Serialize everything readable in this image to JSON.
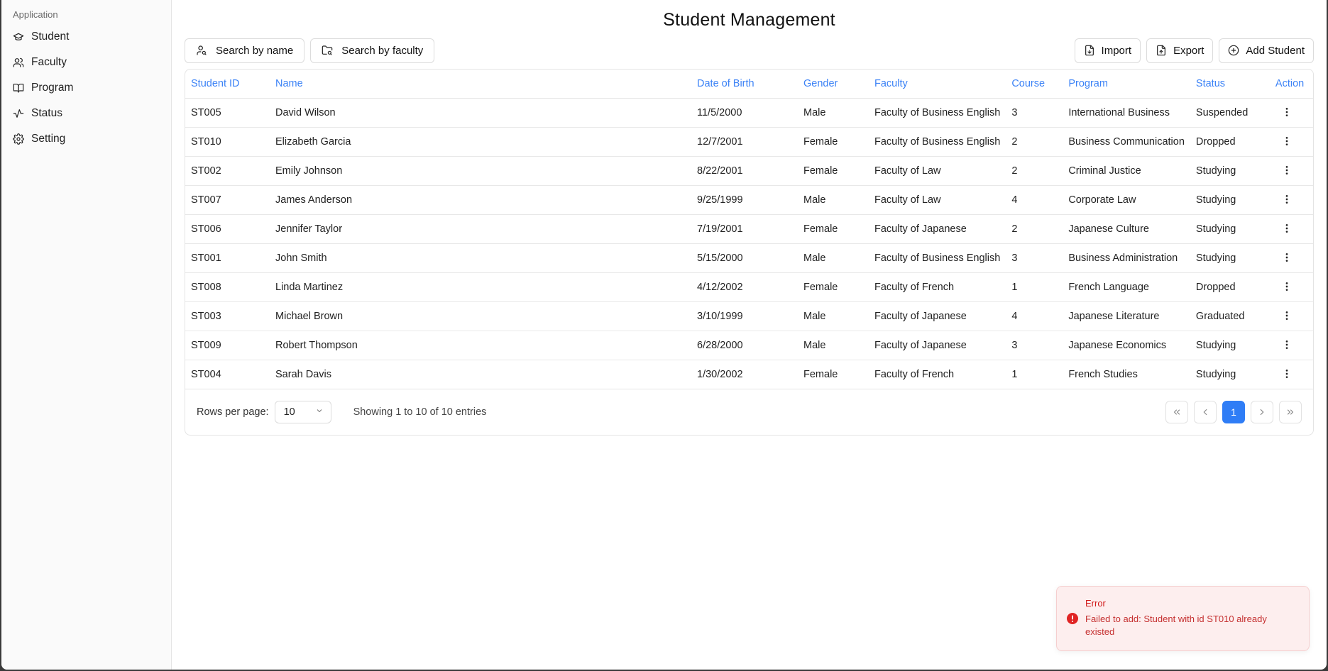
{
  "sidebar": {
    "group_label": "Application",
    "items": [
      {
        "label": "Student",
        "icon": "graduation-cap-icon"
      },
      {
        "label": "Faculty",
        "icon": "users-icon"
      },
      {
        "label": "Program",
        "icon": "book-open-icon"
      },
      {
        "label": "Status",
        "icon": "activity-icon"
      },
      {
        "label": "Setting",
        "icon": "gear-icon"
      }
    ]
  },
  "header": {
    "title": "Student Management"
  },
  "toolbar": {
    "search_name_label": "Search by name",
    "search_faculty_label": "Search by faculty",
    "import_label": "Import",
    "export_label": "Export",
    "add_label": "Add Student"
  },
  "table": {
    "columns": [
      "Student ID",
      "Name",
      "Date of Birth",
      "Gender",
      "Faculty",
      "Course",
      "Program",
      "Status",
      "Action"
    ],
    "rows": [
      [
        "ST005",
        "David Wilson",
        "11/5/2000",
        "Male",
        "Faculty of Business English",
        "3",
        "International Business",
        "Suspended"
      ],
      [
        "ST010",
        "Elizabeth Garcia",
        "12/7/2001",
        "Female",
        "Faculty of Business English",
        "2",
        "Business Communication",
        "Dropped"
      ],
      [
        "ST002",
        "Emily Johnson",
        "8/22/2001",
        "Female",
        "Faculty of Law",
        "2",
        "Criminal Justice",
        "Studying"
      ],
      [
        "ST007",
        "James Anderson",
        "9/25/1999",
        "Male",
        "Faculty of Law",
        "4",
        "Corporate Law",
        "Studying"
      ],
      [
        "ST006",
        "Jennifer Taylor",
        "7/19/2001",
        "Female",
        "Faculty of Japanese",
        "2",
        "Japanese Culture",
        "Studying"
      ],
      [
        "ST001",
        "John Smith",
        "5/15/2000",
        "Male",
        "Faculty of Business English",
        "3",
        "Business Administration",
        "Studying"
      ],
      [
        "ST008",
        "Linda Martinez",
        "4/12/2002",
        "Female",
        "Faculty of French",
        "1",
        "French Language",
        "Dropped"
      ],
      [
        "ST003",
        "Michael Brown",
        "3/10/1999",
        "Male",
        "Faculty of Japanese",
        "4",
        "Japanese Literature",
        "Graduated"
      ],
      [
        "ST009",
        "Robert Thompson",
        "6/28/2000",
        "Male",
        "Faculty of Japanese",
        "3",
        "Japanese Economics",
        "Studying"
      ],
      [
        "ST004",
        "Sarah Davis",
        "1/30/2002",
        "Female",
        "Faculty of French",
        "1",
        "French Studies",
        "Studying"
      ]
    ]
  },
  "pagination": {
    "rows_label": "Rows per page:",
    "rows_value": "10",
    "showing_text": "Showing 1 to 10 of 10 entries",
    "current_page": "1"
  },
  "toast": {
    "title": "Error",
    "message": "Failed to add: Student with id ST010 already existed"
  },
  "colors": {
    "accent": "#2f7df6",
    "header_text": "#3b82f6",
    "error": "#d11a1a",
    "error_bg": "#fdeeee"
  }
}
